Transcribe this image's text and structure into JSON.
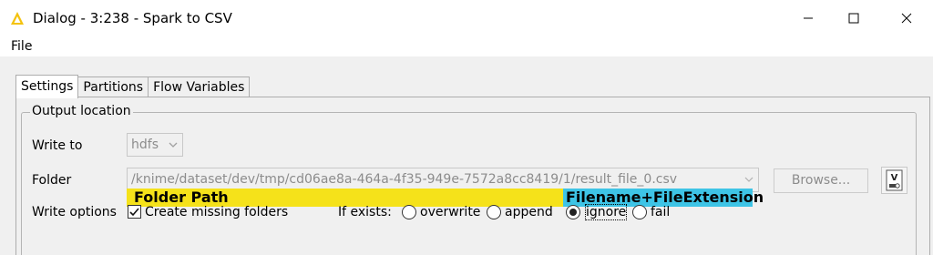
{
  "window": {
    "title": "Dialog - 3:238 - Spark to CSV",
    "icon": "knime-triangle-icon",
    "controls": {
      "minimize": "minimize-icon",
      "maximize": "maximize-icon",
      "close": "close-icon"
    }
  },
  "menu": {
    "items": [
      {
        "label": "File"
      }
    ]
  },
  "tabs": [
    {
      "label": "Settings",
      "active": true
    },
    {
      "label": "Partitions",
      "active": false
    },
    {
      "label": "Flow Variables",
      "active": false
    }
  ],
  "output_location": {
    "group_label": "Output location",
    "write_to": {
      "label": "Write to",
      "value": "hdfs"
    },
    "folder": {
      "label": "Folder",
      "value": "/knime/dataset/dev/tmp/cd06ae8a-464a-4f35-949e-7572a8cc8419/1/result_file_0.csv",
      "browse_label": "Browse..."
    },
    "annotations": {
      "folder_path": "Folder Path",
      "filename_ext": "Filename+FileExtension",
      "folder_color": "#f5e21a",
      "filename_color": "#3ec4e6"
    },
    "write_options": {
      "label": "Write options",
      "create_missing_folders": {
        "label": "Create missing folders",
        "checked": true
      },
      "if_exists_label": "If exists:",
      "options": [
        {
          "label": "overwrite",
          "selected": false
        },
        {
          "label": "append",
          "selected": false
        },
        {
          "label": "ignore",
          "selected": true
        },
        {
          "label": "fail",
          "selected": false
        }
      ]
    }
  }
}
